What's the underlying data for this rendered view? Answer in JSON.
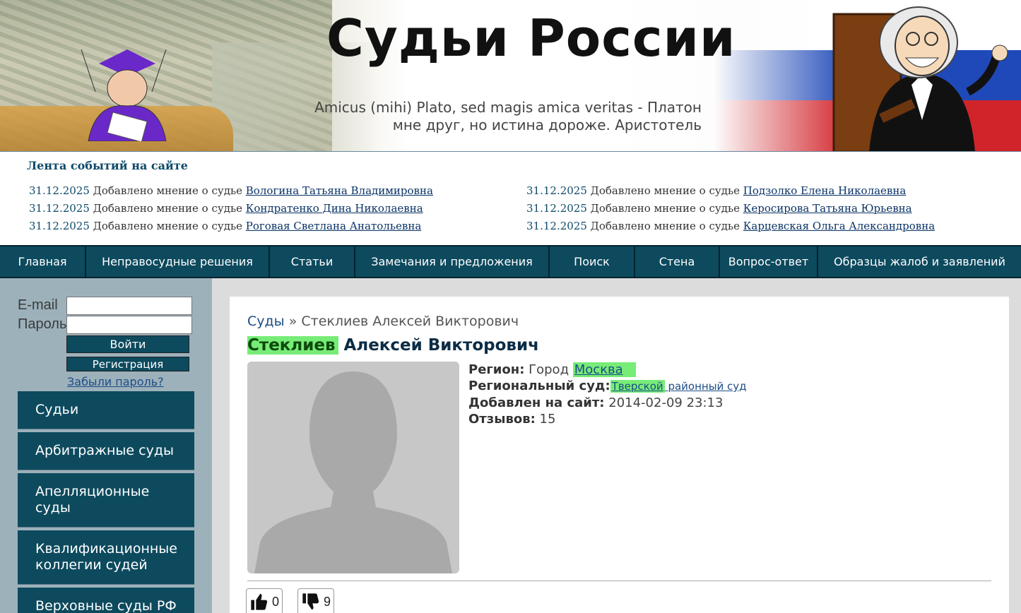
{
  "banner": {
    "title": "Судьи России",
    "motto_line1": "Amicus (mihi) Plato, sed magis amica veritas - Платон",
    "motto_line2": "мне друг, но истина дороже. Аристотель"
  },
  "feed": {
    "title": "Лента событий на сайте",
    "left": [
      {
        "date": "31.12.2025",
        "text": " Добавлено мнение о судье ",
        "link": "Вологина Татьяна Владимировна"
      },
      {
        "date": "31.12.2025",
        "text": " Добавлено мнение о судье ",
        "link": "Кондратенко Дина Николаевна"
      },
      {
        "date": "31.12.2025",
        "text": " Добавлено мнение о судье ",
        "link": "Роговая Светлана Анатольевна"
      }
    ],
    "right": [
      {
        "date": "31.12.2025",
        "text": " Добавлено мнение о судье ",
        "link": "Подзолко Елена Николаевна"
      },
      {
        "date": "31.12.2025",
        "text": " Добавлено мнение о судье ",
        "link": "Керосирова Татьяна Юрьевна"
      },
      {
        "date": "31.12.2025",
        "text": " Добавлено мнение о судье ",
        "link": "Карцевская Ольга Александровна"
      }
    ]
  },
  "nav": [
    "Главная",
    "Неправосудные решения",
    "Статьи",
    "Замечания и предложения",
    "Поиск",
    "Стена",
    "Вопрос-ответ",
    "Образцы жалоб и заявлений"
  ],
  "login": {
    "email_label": "E-mail",
    "password_label": "Пароль",
    "email_value": "",
    "password_value": "",
    "login_button": "Войти",
    "register_button": "Регистрация",
    "forgot_link": "Забыли пароль?"
  },
  "sidebar_menu": [
    "Судьи",
    "Арбитражные суды",
    "Апелляционные суды",
    "Квалификационные коллегии судей",
    "Верховные суды РФ"
  ],
  "profile": {
    "breadcrumb_link": "Суды",
    "breadcrumb_sep": " » ",
    "breadcrumb_current": "Стеклиев Алексей Викторович",
    "surname": "Стеклиев",
    "given_names": " Алексей Викторович",
    "region_label": "Регион:",
    "region_prefix": " Город ",
    "region_city": "Москва",
    "court_label": "Региональный суд:",
    "court_name_hl": "Тверской",
    "court_name_rest": " районный суд",
    "added_label": "Добавлен на сайт:",
    "added_value": " 2014-02-09 23:13",
    "reviews_label": "Отзывов:",
    "reviews_value": " 15",
    "likes": "0",
    "dislikes": "9"
  },
  "colors": {
    "nav_bg": "#0d4a5e",
    "highlight": "#77ec77",
    "link": "#1c4d86"
  }
}
